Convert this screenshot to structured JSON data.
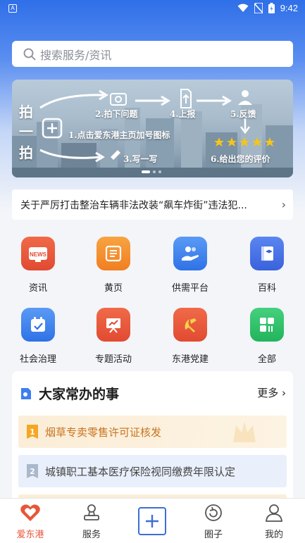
{
  "status_bar": {
    "time": "9:42",
    "left_icon_letter": "A"
  },
  "search": {
    "placeholder": "搜索服务/资讯"
  },
  "banner": {
    "left_chars": [
      "拍",
      "一",
      "拍"
    ],
    "step1": "1.点击爱东港主页加号图标",
    "step2": "2.拍下问题",
    "step3": "3.写一写",
    "step4": "4.上报",
    "step5": "5.反馈",
    "step6": "6.给出您的评价",
    "rating_stars": 5
  },
  "notice": {
    "text": "关于严厉打击整治车辆非法改装“飙车炸街”违法犯..."
  },
  "services": [
    {
      "label": "资讯",
      "icon": "news-icon",
      "color": "#e8553a"
    },
    {
      "label": "黄页",
      "icon": "yellow-pages-icon",
      "color": "#f08a2c"
    },
    {
      "label": "供需平台",
      "icon": "supply-demand-icon",
      "color": "#3d7ff0"
    },
    {
      "label": "百科",
      "icon": "encyclopedia-icon",
      "color": "#4a76e8"
    },
    {
      "label": "社会治理",
      "icon": "calendar-check-icon",
      "color": "#3d7ff0"
    },
    {
      "label": "专题活动",
      "icon": "presentation-icon",
      "color": "#e8553a"
    },
    {
      "label": "东港党建",
      "icon": "party-emblem-icon",
      "color": "#e8553a"
    },
    {
      "label": "全部",
      "icon": "grid-all-icon",
      "color": "#2fbf6a"
    }
  ],
  "common_tasks": {
    "title": "大家常办的事",
    "more": "更多",
    "items": [
      {
        "rank": "1",
        "label": "烟草专卖零售许可证核发"
      },
      {
        "rank": "2",
        "label": "城镇职工基本医疗保险视同缴费年限认定"
      }
    ]
  },
  "tabbar": [
    {
      "label": "爱东港",
      "icon": "heart-icon",
      "active": true
    },
    {
      "label": "服务",
      "icon": "service-stamp-icon",
      "active": false
    },
    {
      "label": "",
      "icon": "plus-icon",
      "active": false
    },
    {
      "label": "圈子",
      "icon": "circle-refresh-icon",
      "active": false
    },
    {
      "label": "我的",
      "icon": "user-icon",
      "active": false
    }
  ]
}
